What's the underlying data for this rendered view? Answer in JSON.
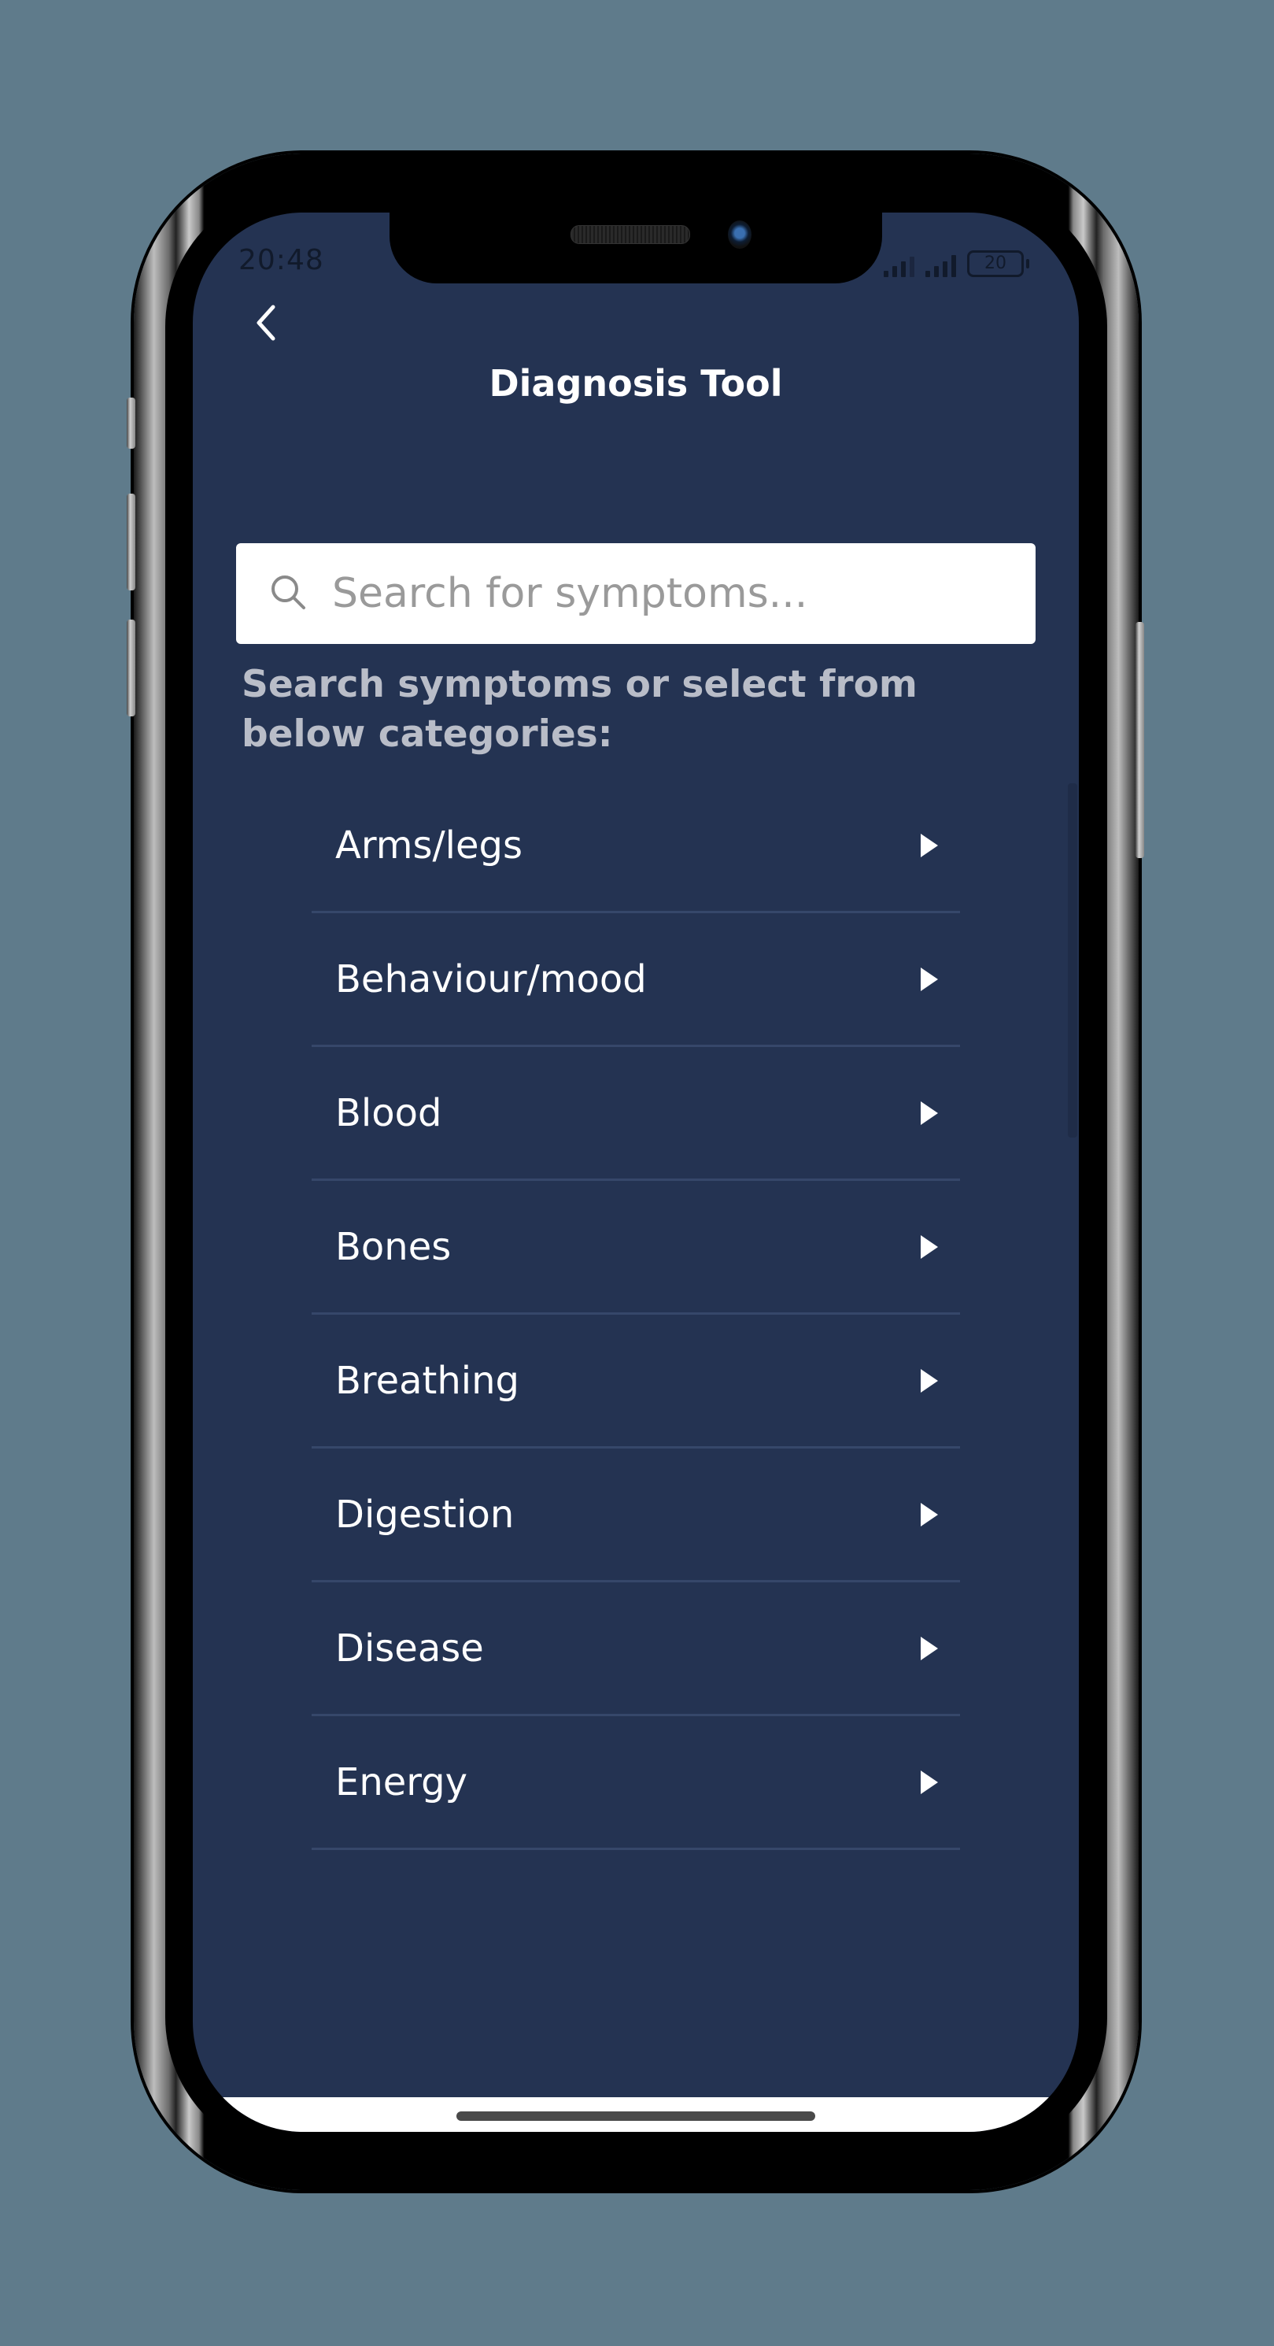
{
  "status_bar": {
    "time": "20:48",
    "battery": "20",
    "icons": [
      "signal-icon",
      "signal-icon",
      "battery-icon"
    ]
  },
  "header": {
    "back_icon": "chevron-left-icon",
    "title": "Diagnosis Tool"
  },
  "search": {
    "icon": "search-icon",
    "value": "",
    "placeholder": "Search for symptoms..."
  },
  "hint": "Search symptoms or select from below categories:",
  "categories": [
    {
      "label": "Arms/legs",
      "icon": "caret-right-icon"
    },
    {
      "label": "Behaviour/mood",
      "icon": "caret-right-icon"
    },
    {
      "label": "Blood",
      "icon": "caret-right-icon"
    },
    {
      "label": "Bones",
      "icon": "caret-right-icon"
    },
    {
      "label": "Breathing",
      "icon": "caret-right-icon"
    },
    {
      "label": "Digestion",
      "icon": "caret-right-icon"
    },
    {
      "label": "Disease",
      "icon": "caret-right-icon"
    },
    {
      "label": "Energy",
      "icon": "caret-right-icon"
    }
  ],
  "colors": {
    "background": "#5f7b8b",
    "screen": "#243352",
    "separator": "#36476a",
    "hint_text": "#b9bdc8",
    "placeholder": "#9a9a9a"
  }
}
